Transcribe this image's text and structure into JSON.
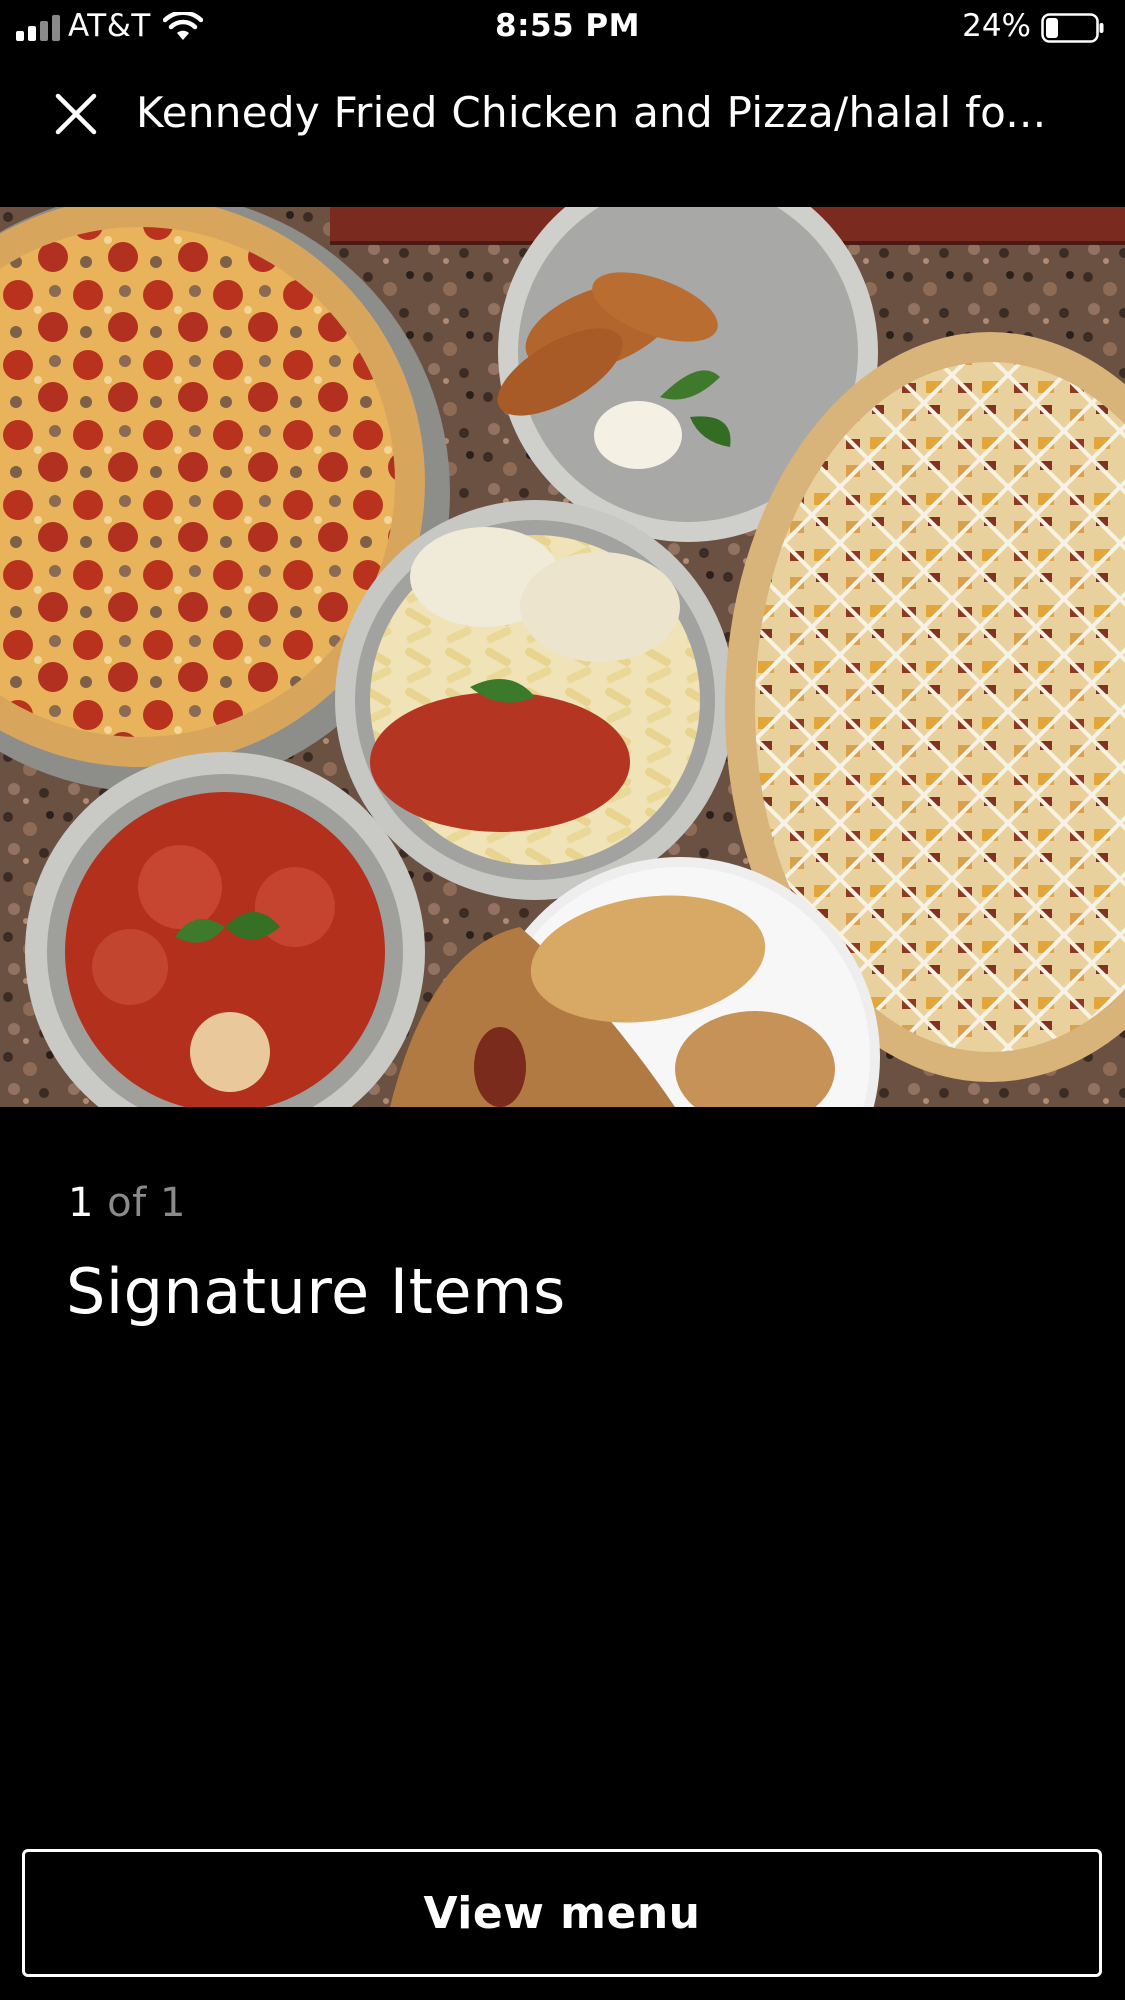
{
  "status_bar": {
    "carrier": "AT&T",
    "time": "8:55 PM",
    "battery_percent": "24%",
    "battery_level": 0.24,
    "signal_bars": 2,
    "signal_bars_total": 4
  },
  "header": {
    "close_icon": "close-icon",
    "title": "Kennedy Fried Chicken and Pizza/halal fo..."
  },
  "gallery": {
    "current": "1",
    "of_total": " of 1",
    "caption": "Signature Items"
  },
  "footer": {
    "view_menu_label": "View menu"
  },
  "colors": {
    "background": "#000000",
    "text": "#ffffff",
    "muted_text": "#8a8a8a"
  }
}
